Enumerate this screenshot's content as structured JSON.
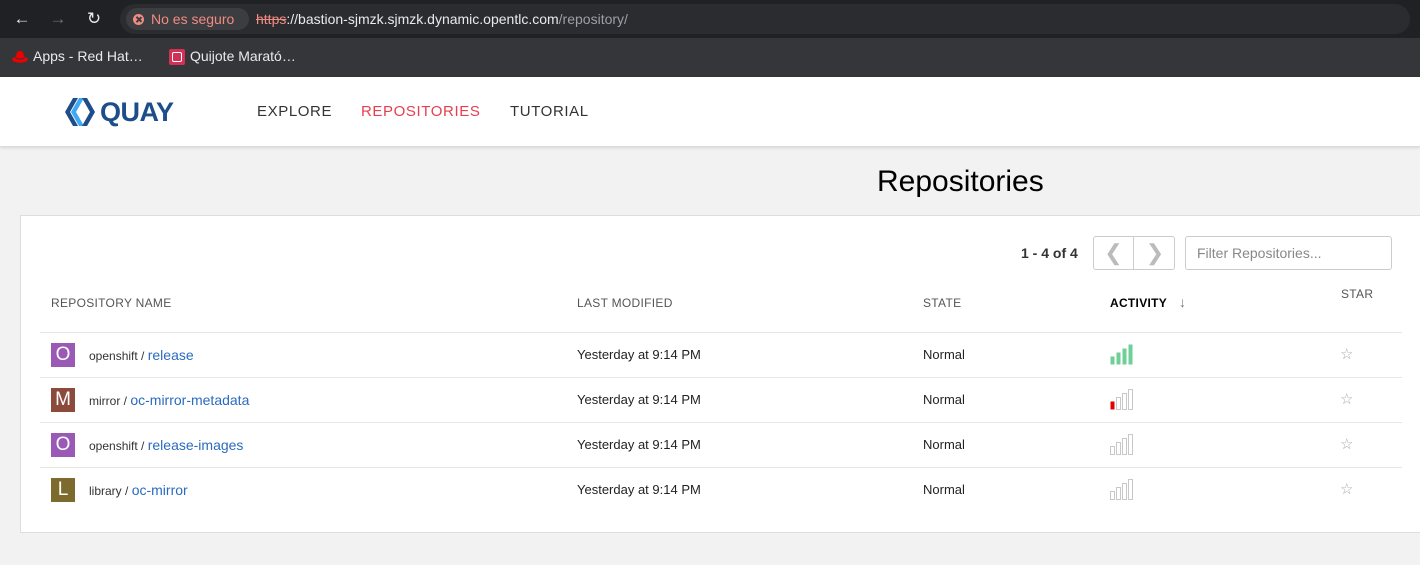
{
  "browser": {
    "security_chip": "No es seguro",
    "url_scheme": "https",
    "url_host": "://bastion-sjmzk.sjmzk.dynamic.opentlc.com",
    "url_path": "/repository/",
    "bookmarks": [
      {
        "label": "Apps - Red Hat…",
        "icon": "redhat-icon"
      },
      {
        "label": "Quijote Marató…",
        "icon": "quijote-icon"
      }
    ]
  },
  "app": {
    "logo": "QUAY",
    "nav": [
      {
        "label": "EXPLORE",
        "active": false
      },
      {
        "label": "REPOSITORIES",
        "active": true
      },
      {
        "label": "TUTORIAL",
        "active": false
      }
    ]
  },
  "page": {
    "title": "Repositories",
    "count": "1 - 4 of 4",
    "filter_placeholder": "Filter Repositories...",
    "columns": {
      "name": "REPOSITORY NAME",
      "modified": "LAST MODIFIED",
      "state": "STATE",
      "activity": "ACTIVITY",
      "star": "STAR"
    },
    "sort_indicator": "↓"
  },
  "repos": [
    {
      "avatar": "O",
      "avatar_color": "#9b59b6",
      "namespace": "openshift / ",
      "name": "release",
      "modified": "Yesterday at 9:14 PM",
      "state": "Normal",
      "activity": [
        1,
        2,
        3,
        4
      ],
      "activity_color": "#6fcf97",
      "star": "☆"
    },
    {
      "avatar": "M",
      "avatar_color": "#8b4a3c",
      "namespace": "mirror / ",
      "name": "oc-mirror-metadata",
      "modified": "Yesterday at 9:14 PM",
      "state": "Normal",
      "activity": [
        1,
        0,
        0,
        0
      ],
      "activity_color": "#e00000",
      "star": "☆"
    },
    {
      "avatar": "O",
      "avatar_color": "#9b59b6",
      "namespace": "openshift / ",
      "name": "release-images",
      "modified": "Yesterday at 9:14 PM",
      "state": "Normal",
      "activity": [
        0,
        0,
        0,
        0
      ],
      "activity_color": "#cccccc",
      "star": "☆"
    },
    {
      "avatar": "L",
      "avatar_color": "#7d6b2e",
      "namespace": "library / ",
      "name": "oc-mirror",
      "modified": "Yesterday at 9:14 PM",
      "state": "Normal",
      "activity": [
        0,
        0,
        0,
        0
      ],
      "activity_color": "#cccccc",
      "star": "☆"
    }
  ]
}
